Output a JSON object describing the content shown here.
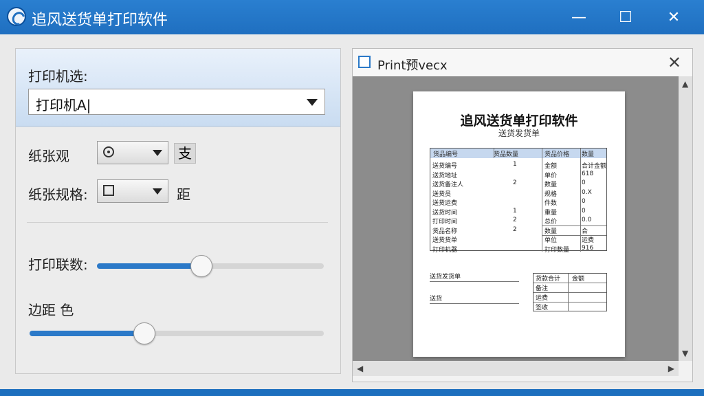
{
  "window": {
    "title": "追风送货单打印软件",
    "minimize": "—",
    "maximize": "☐",
    "close": "✕"
  },
  "left_panel": {
    "printer_label": "打印机选:",
    "printer_value": "打印机A|",
    "paper_label": "纸张观",
    "paper_option": "支",
    "paper_size_label": "纸张规格:",
    "paper_size_option": "距",
    "copies_label": "打印联数:",
    "copies_slider": 0.46,
    "margin_label": "边距 色",
    "margin_slider": 0.39
  },
  "preview": {
    "title": "Print预veсx",
    "close": "✕",
    "doc_title": "追风送货单打印软件",
    "doc_subtitle": "送货发货单",
    "table_header": [
      "货品编号",
      "货品数量",
      "货品价格",
      "数量"
    ],
    "left_rows": [
      "送货编号",
      "送货地址",
      "送货备注人",
      "送货员",
      "送货运费",
      "送货时间",
      "打印时间",
      "货品名称",
      "送货货单",
      "打印机器"
    ],
    "middle_values": [
      "1",
      "",
      "2",
      "",
      "",
      "1",
      "2",
      "2",
      "",
      ""
    ],
    "right_rows": [
      "金额",
      "单价",
      "数量",
      "规格",
      "件数",
      "重量",
      "总价",
      "数量",
      "单位",
      "打印数量"
    ],
    "far_values": [
      "合计金额",
      "618",
      "0",
      "0.X",
      "0",
      "0",
      "0.0",
      "合",
      "运费",
      "916"
    ],
    "bottom_left": "送货发货单",
    "bottom_left2": "送货",
    "mini_table": [
      "货款合计",
      "金额",
      "备注",
      "运费",
      "签收"
    ]
  },
  "colors": {
    "titlebar": "#1f6fc0",
    "accent": "#2b79c8"
  }
}
